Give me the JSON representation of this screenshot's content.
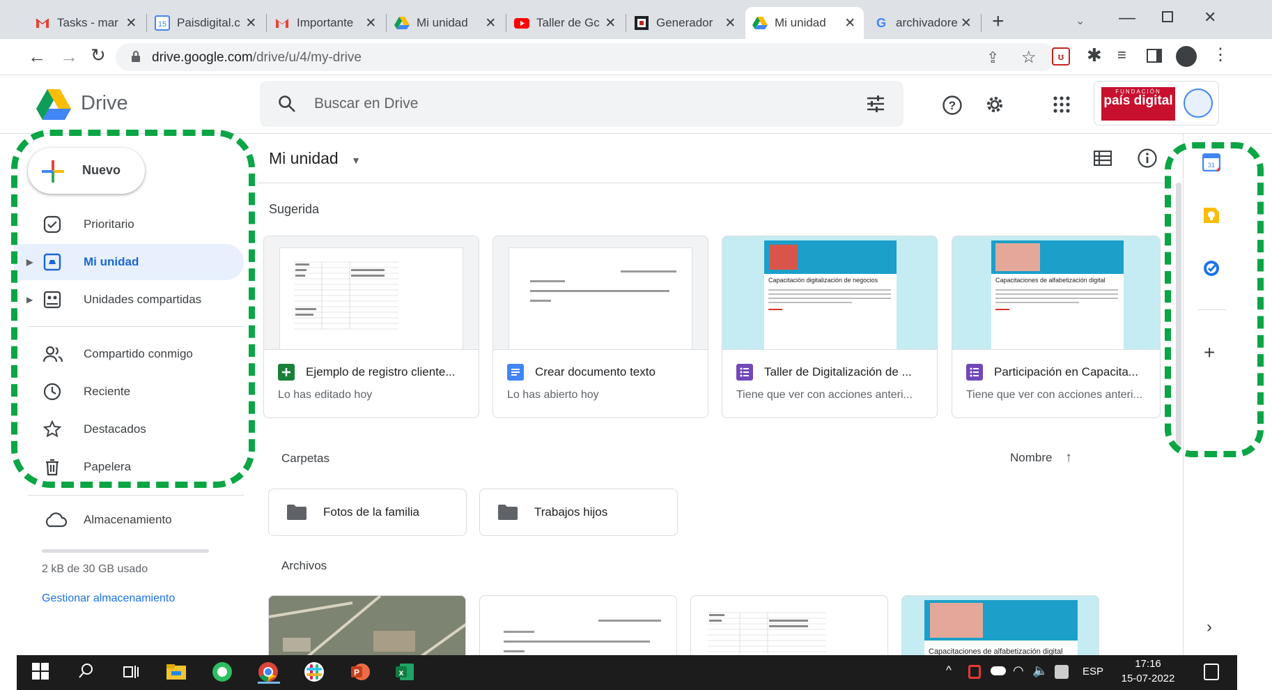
{
  "browser": {
    "tabs": [
      {
        "label": "Tasks - mar",
        "icon": "gmail-icon"
      },
      {
        "label": "Paisdigital.c",
        "icon": "calendar-icon"
      },
      {
        "label": "Importante",
        "icon": "gmail-icon"
      },
      {
        "label": "Mi unidad",
        "icon": "drive-icon"
      },
      {
        "label": "Taller de Gc",
        "icon": "youtube-icon"
      },
      {
        "label": "Generador",
        "icon": "generator-icon"
      },
      {
        "label": "Mi unidad",
        "icon": "drive-icon",
        "active": true
      },
      {
        "label": "archivadore",
        "icon": "google-icon"
      }
    ],
    "url_host": "drive.google.com",
    "url_path": "/drive/u/4/my-drive"
  },
  "drive": {
    "app_name": "Drive",
    "search_placeholder": "Buscar en Drive",
    "new_button": "Nuevo",
    "nav": [
      {
        "label": "Prioritario",
        "icon": "priority-icon"
      },
      {
        "label": "Mi unidad",
        "icon": "my-drive-icon",
        "active": true
      },
      {
        "label": "Unidades compartidas",
        "icon": "shared-drives-icon"
      },
      {
        "label": "Compartido conmigo",
        "icon": "shared-with-me-icon"
      },
      {
        "label": "Reciente",
        "icon": "clock-icon"
      },
      {
        "label": "Destacados",
        "icon": "star-icon"
      },
      {
        "label": "Papelera",
        "icon": "trash-icon"
      },
      {
        "label": "Almacenamiento",
        "icon": "cloud-icon"
      }
    ],
    "storage": {
      "used_text": "2 kB de 30 GB usado",
      "used_fraction": 0.0,
      "manage": "Gestionar almacenamiento"
    },
    "location_title": "Mi unidad",
    "suggested_heading": "Sugerida",
    "suggested": [
      {
        "title": "Ejemplo de registro cliente...",
        "subtitle": "Lo has editado hoy",
        "type": "sheets",
        "color": "#188038"
      },
      {
        "title": "Crear documento texto",
        "subtitle": "Lo has abierto hoy",
        "type": "docs",
        "color": "#4285f4"
      },
      {
        "title": "Taller de Digitalización de ...",
        "subtitle": "Tiene que ver con acciones anteri...",
        "type": "forms",
        "color": "#7248b9",
        "thumb_text": "Capacitación digitalización de negocios"
      },
      {
        "title": "Participación en Capacita...",
        "subtitle": "Tiene que ver con acciones anteri...",
        "type": "forms",
        "color": "#7248b9",
        "thumb_text": "Capacitaciones de alfabetización digital"
      }
    ],
    "folders_heading": "Carpetas",
    "sort_label": "Nombre",
    "folders": [
      {
        "name": "Fotos de la familia"
      },
      {
        "name": "Trabajos hijos"
      }
    ],
    "files_heading": "Archivos",
    "files_thumb_text": "Capacitaciones de alfabetización digital",
    "brand_logo_text": "país digital",
    "brand_logo_top": "FUNDACIÓN"
  },
  "taskbar": {
    "time": "17:16",
    "date": "15-07-2022",
    "lang": "ESP"
  },
  "colors": {
    "accent_green": "#0aa544",
    "drive_blue": "#1967d2",
    "active_bg": "#e8f0fe"
  }
}
